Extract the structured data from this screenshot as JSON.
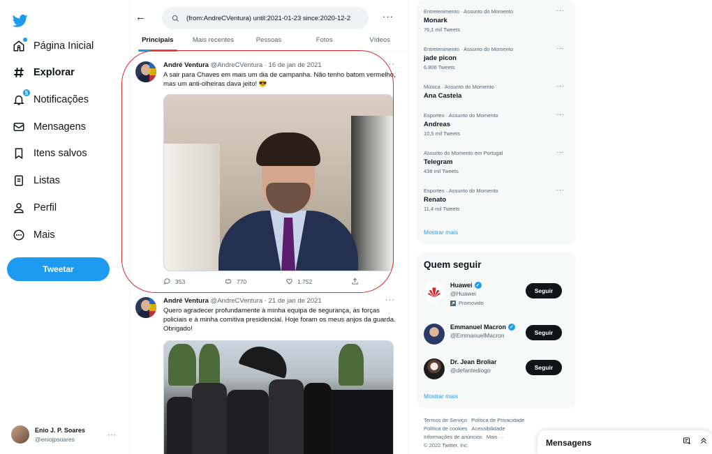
{
  "nav": {
    "items": [
      {
        "label": "Página Inicial",
        "icon": "home-icon"
      },
      {
        "label": "Explorar",
        "icon": "hashtag-icon"
      },
      {
        "label": "Notificações",
        "icon": "bell-icon",
        "badge": "5"
      },
      {
        "label": "Mensagens",
        "icon": "envelope-icon"
      },
      {
        "label": "Itens salvos",
        "icon": "bookmark-icon"
      },
      {
        "label": "Listas",
        "icon": "list-icon"
      },
      {
        "label": "Perfil",
        "icon": "person-icon"
      },
      {
        "label": "Mais",
        "icon": "more-circle-icon"
      }
    ],
    "tweet_button": "Tweetar",
    "user": {
      "name": "Enio J. P. Soares",
      "handle": "@eniojpsoares"
    }
  },
  "search": {
    "query": "(from:AndreCVentura) until:2021-01-23 since:2020-12-2"
  },
  "tabs": [
    {
      "label": "Principais",
      "active": true
    },
    {
      "label": "Mais recentes",
      "active": false
    },
    {
      "label": "Pessoas",
      "active": false
    },
    {
      "label": "Fotos",
      "active": false
    },
    {
      "label": "Vídeos",
      "active": false
    }
  ],
  "tweets": [
    {
      "name": "André Ventura",
      "meta": "@AndreCVentura · 16 de jan de 2021",
      "text": "A sair para Chaves em mais um dia de campanha. Não tenho batom vermelho, mas um anti-olheiras dava jeito! 😎",
      "replies": "353",
      "retweets": "770",
      "likes": "1.752"
    },
    {
      "name": "André Ventura",
      "meta": "@AndreCVentura · 21 de jan de 2021",
      "text": "Quero agradecer profundamente à minha equipa de segurança, às forças policiais e à minha comitiva presidencial. Hoje foram os meus anjos da guarda. Obrigado!"
    }
  ],
  "trends": [
    {
      "category": "Entretenimento · Assunto do Momento",
      "name": "Monark",
      "count": "76,1 mil Tweets"
    },
    {
      "category": "Entretenimento · Assunto do Momento",
      "name": "jade picon",
      "count": "6.806 Tweets"
    },
    {
      "category": "Música · Assunto do Momento",
      "name": "Ana Castela",
      "count": ""
    },
    {
      "category": "Esportes · Assunto do Momento",
      "name": "Andreas",
      "count": "10,5 mil Tweets"
    },
    {
      "category": "Assunto do Momento em Portugal",
      "name": "Telegram",
      "count": "438 mil Tweets"
    },
    {
      "category": "Esportes · Assunto do Momento",
      "name": "Renato",
      "count": "11,4 mil Tweets"
    }
  ],
  "trends_show_more": "Mostrar mais",
  "who_to_follow": {
    "title": "Quem seguir",
    "accounts": [
      {
        "name": "Huawei",
        "handle": "@Huawei",
        "promo": "Promovido",
        "button": "Seguir"
      },
      {
        "name": "Emmanuel Macron",
        "handle": "@EmmanuelMacron",
        "button": "Seguir"
      },
      {
        "name": "Dr. Jean Broliar",
        "handle": "@defantediogo",
        "button": "Seguir"
      }
    ],
    "show_more": "Mostrar mais"
  },
  "footer": {
    "links": [
      "Termos de Serviço",
      "Política de Privacidade",
      "Política de cookies",
      "Acessibilidade",
      "Informações de anúncios",
      "Mais ···"
    ],
    "copyright": "© 2022 Twitter, Inc."
  },
  "messages_drawer": {
    "title": "Mensagens"
  },
  "colors": {
    "accent": "#1d9bf0",
    "highlight": "#e0282c",
    "text": "#0f1419",
    "muted": "#536471"
  }
}
